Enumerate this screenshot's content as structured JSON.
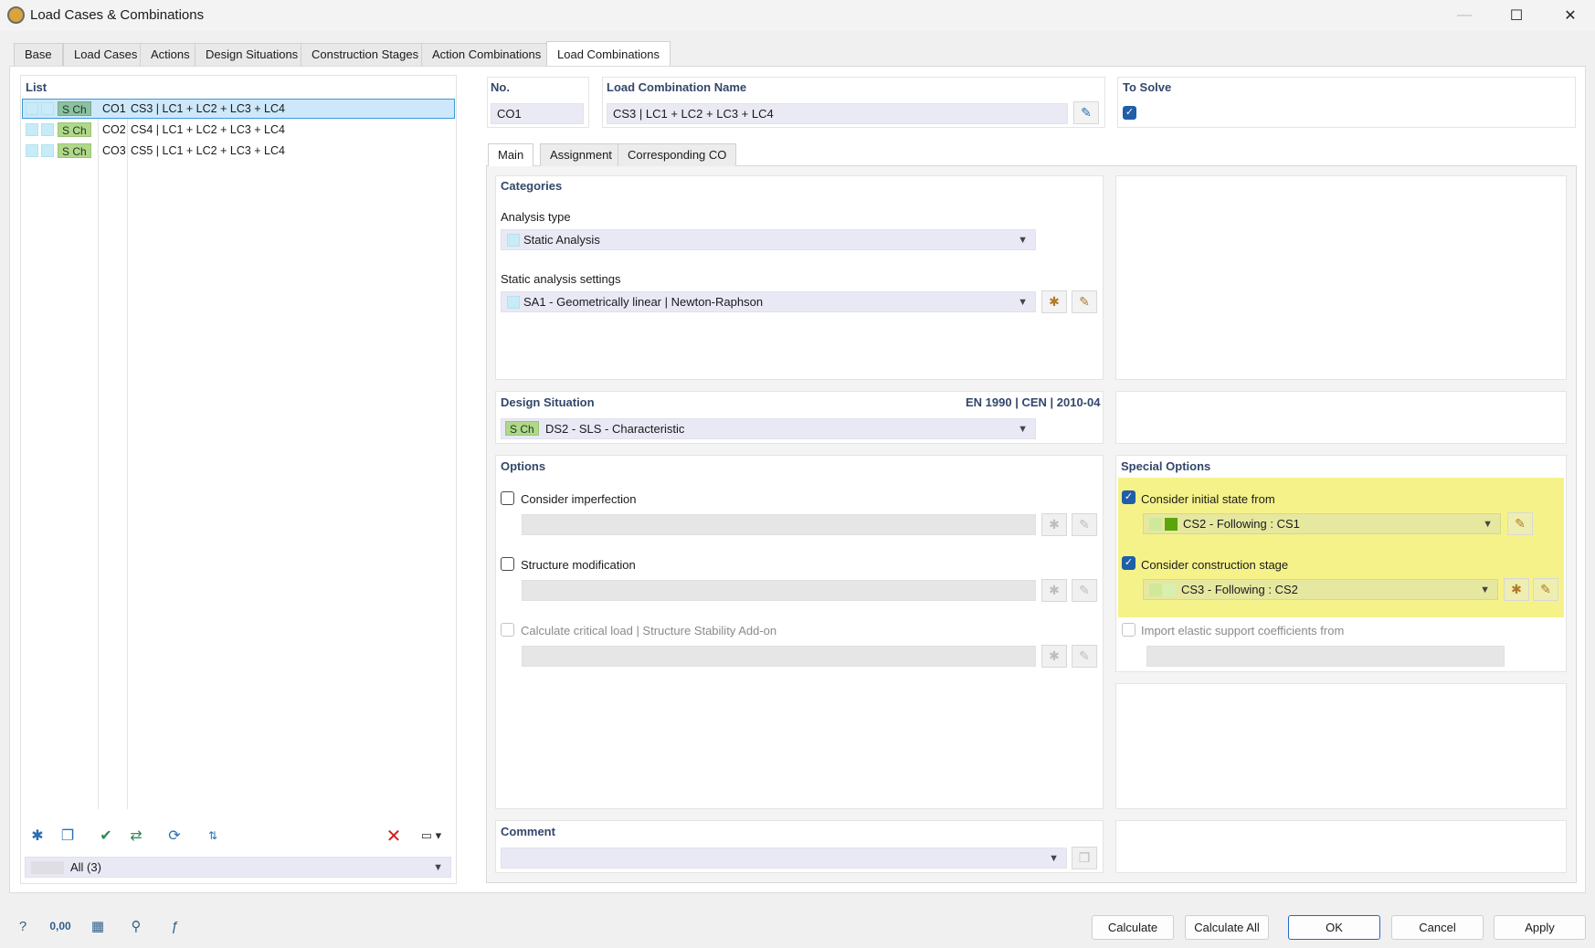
{
  "window": {
    "title": "Load Cases & Combinations",
    "minimize": "—",
    "maximize": "☐",
    "close": "✕"
  },
  "tabs": [
    {
      "label": "Base"
    },
    {
      "label": "Load Cases"
    },
    {
      "label": "Actions"
    },
    {
      "label": "Design Situations"
    },
    {
      "label": "Construction Stages"
    },
    {
      "label": "Action Combinations"
    },
    {
      "label": "Load Combinations"
    }
  ],
  "list": {
    "header": "List",
    "rows": [
      {
        "badge": "S Ch",
        "id": "CO1",
        "name": "CS3 | LC1 + LC2 + LC3 + LC4"
      },
      {
        "badge": "S Ch",
        "id": "CO2",
        "name": "CS4 | LC1 + LC2 + LC3 + LC4"
      },
      {
        "badge": "S Ch",
        "id": "CO3",
        "name": "CS5 | LC1 + LC2 + LC3 + LC4"
      }
    ],
    "filter": "All (3)"
  },
  "header": {
    "no_label": "No.",
    "no_value": "CO1",
    "name_label": "Load Combination Name",
    "name_value": "CS3 | LC1 + LC2 + LC3 + LC4",
    "to_solve_label": "To Solve"
  },
  "subtabs": [
    {
      "label": "Main"
    },
    {
      "label": "Assignment"
    },
    {
      "label": "Corresponding CO"
    }
  ],
  "categories": {
    "header": "Categories",
    "analysis_type_label": "Analysis type",
    "analysis_type_value": "Static Analysis",
    "settings_label": "Static analysis settings",
    "settings_value": "SA1 - Geometrically linear | Newton-Raphson"
  },
  "design_situation": {
    "header": "Design Situation",
    "standard": "EN 1990 | CEN | 2010-04",
    "badge": "S Ch",
    "value": "DS2 - SLS - Characteristic"
  },
  "options": {
    "header": "Options",
    "imperfection": "Consider imperfection",
    "structure_modification": "Structure modification",
    "critical_load": "Calculate critical load | Structure Stability Add-on"
  },
  "special_options": {
    "header": "Special Options",
    "initial_state": "Consider initial state from",
    "initial_state_value": "CS2 - Following : CS1",
    "construction_stage": "Consider construction stage",
    "construction_stage_value": "CS3 - Following : CS2",
    "elastic_support": "Import elastic support coefficients from"
  },
  "comment": {
    "header": "Comment"
  },
  "footer": {
    "calculate": "Calculate",
    "calculate_all": "Calculate All",
    "ok": "OK",
    "cancel": "Cancel",
    "apply": "Apply",
    "units_icon_text": "0,00"
  },
  "colors": {
    "header_text": "#33476b",
    "highlight": "#f6f28a",
    "accent": "#2468c4",
    "badge_green": "#b0d78a"
  }
}
